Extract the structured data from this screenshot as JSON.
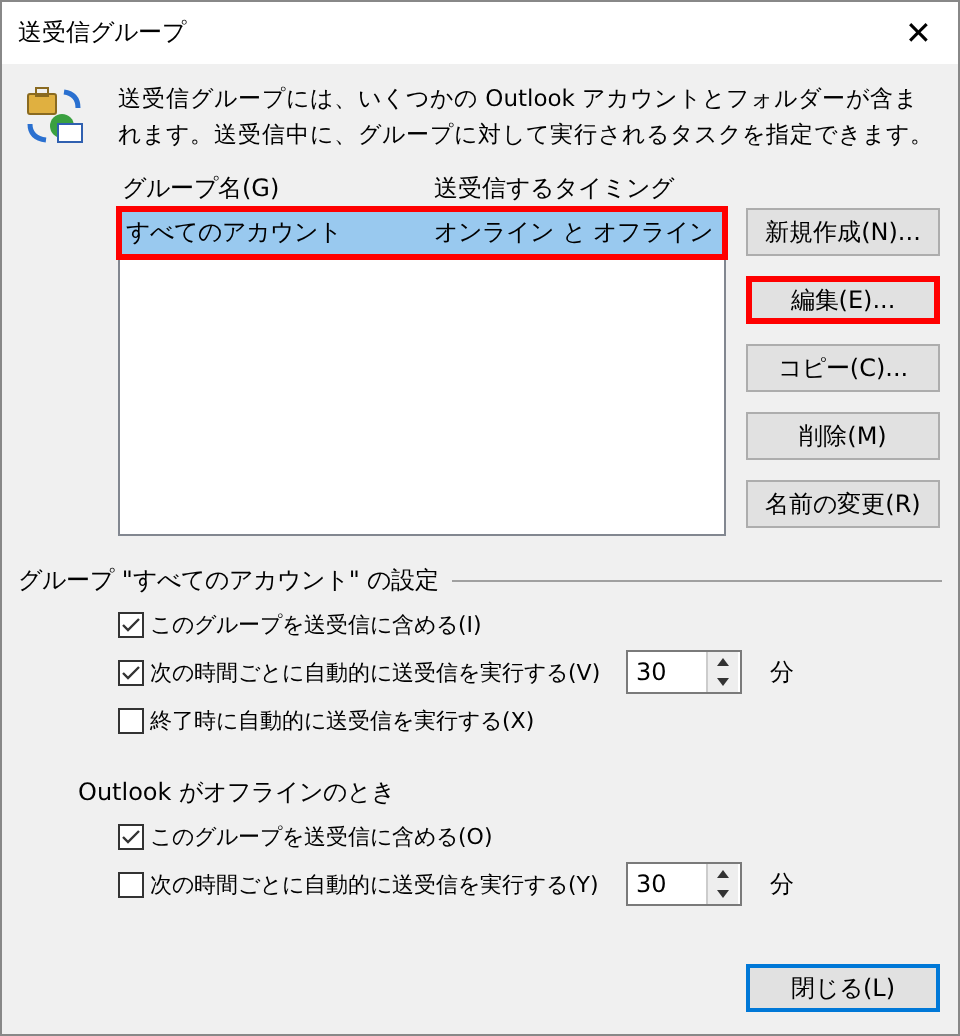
{
  "window": {
    "title": "送受信グループ",
    "close": "✕"
  },
  "description": "送受信グループには、いくつかの Outlook アカウントとフォルダーが含まれます。送受信中に、グループに対して実行されるタスクを指定できます。",
  "groups": {
    "columns": [
      "グループ名(G)",
      "送受信するタイミング"
    ],
    "rows": [
      {
        "name": "すべてのアカウント",
        "timing": "オンライン と オフライン",
        "selected": true,
        "highlighted": true
      }
    ]
  },
  "side_buttons": [
    {
      "label": "新規作成(N)...",
      "highlighted": false
    },
    {
      "label": "編集(E)...",
      "highlighted": true
    },
    {
      "label": "コピー(C)...",
      "highlighted": false
    },
    {
      "label": "削除(M)",
      "highlighted": false
    },
    {
      "label": "名前の変更(R)",
      "highlighted": false
    }
  ],
  "sections": [
    {
      "title": "グループ \"すべてのアカウント\" の設定",
      "kind": "group",
      "options": [
        {
          "label": "このグループを送受信に含める(I)",
          "checked": true
        },
        {
          "label": "次の時間ごとに自動的に送受信を実行する(V)",
          "checked": true,
          "value": "30",
          "unit": "分"
        },
        {
          "label": "終了時に自動的に送受信を実行する(X)",
          "checked": false
        }
      ]
    },
    {
      "title": "Outlook がオフラインのとき",
      "kind": "plain",
      "options": [
        {
          "label": "このグループを送受信に含める(O)",
          "checked": true
        },
        {
          "label": "次の時間ごとに自動的に送受信を実行する(Y)",
          "checked": false,
          "value": "30",
          "unit": "分"
        }
      ]
    }
  ],
  "footer_buttons": [
    {
      "label": "閉じる(L)",
      "default": true
    }
  ]
}
